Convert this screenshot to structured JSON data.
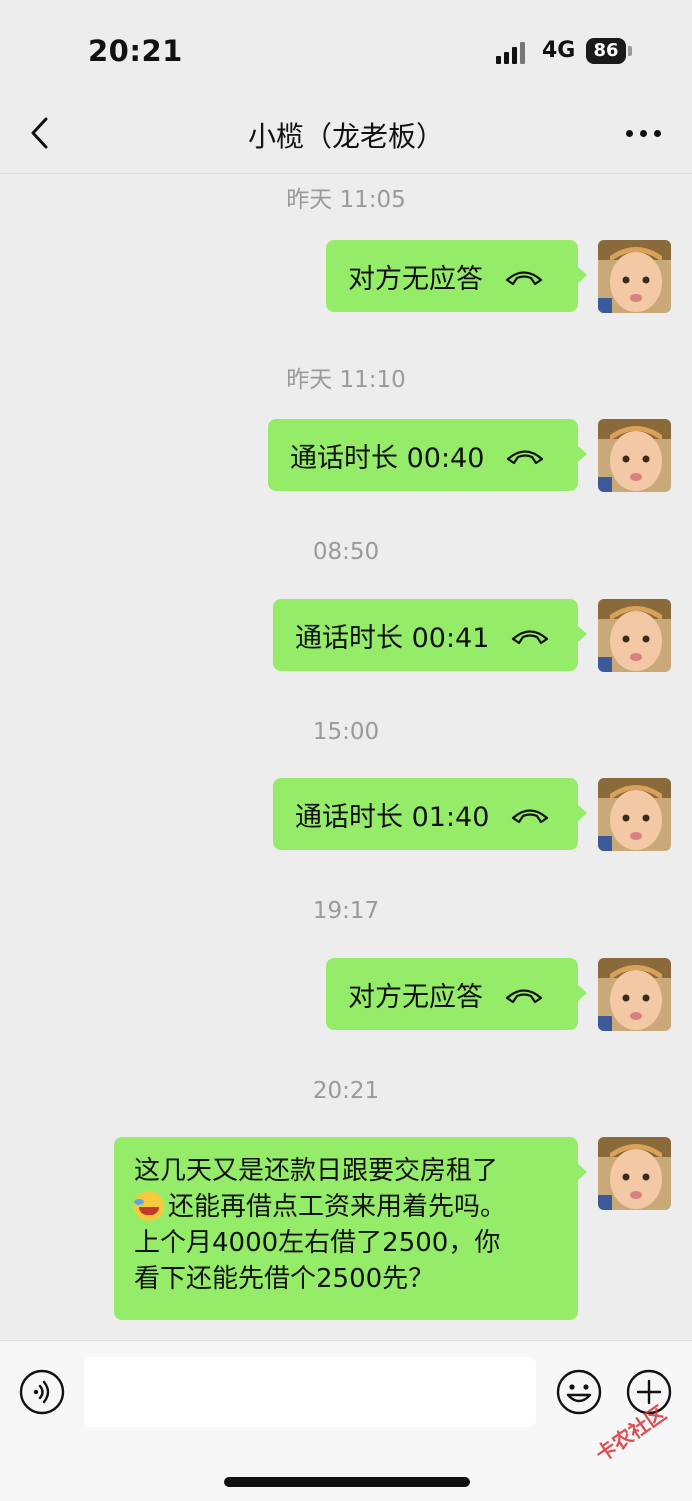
{
  "status_bar": {
    "time": "20:21",
    "network": "4G",
    "battery": "86"
  },
  "header": {
    "title": "小榄（龙老板）"
  },
  "messages": [
    {
      "time": "昨天 11:05",
      "text": "对方无应答"
    },
    {
      "time": "昨天 11:10",
      "text": "通话时长 00:40"
    },
    {
      "time": "08:50",
      "text": "通话时长 00:41"
    },
    {
      "time": "15:00",
      "text": "通话时长 01:40"
    },
    {
      "time": "19:17",
      "text": "对方无应答"
    },
    {
      "time": "20:21",
      "lines": [
        "这几天又是还款日跟要交房租了",
        "还能再借点工资来用着先吗。",
        "上个月4000左右借了2500，你",
        "看下还能先借个2500先？"
      ]
    }
  ],
  "watermark": "卡农社区",
  "colors": {
    "bubble": "#95ec69",
    "background": "#ededed"
  }
}
